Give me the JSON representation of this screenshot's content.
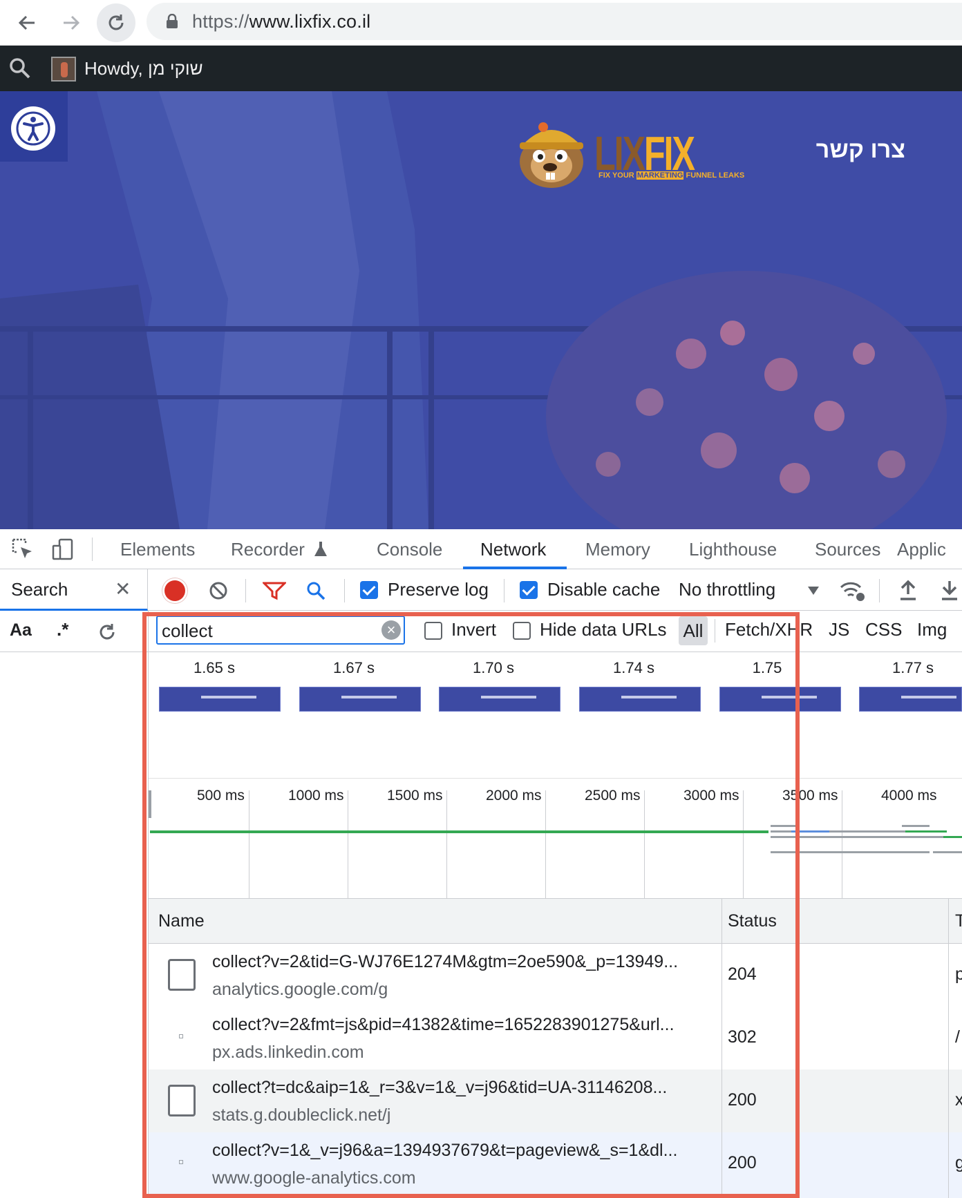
{
  "browser": {
    "url_scheme": "https://",
    "url_host": "www.lixfix.co.il"
  },
  "admin_bar": {
    "howdy": "Howdy, שוקי מן"
  },
  "hero": {
    "logo_lix": "LIX",
    "logo_fix": "FIX",
    "logo_tagline_1": "FIX YOUR ",
    "logo_tagline_hl": "MARKETING",
    "logo_tagline_2": " FUNNEL LEAKS",
    "contact_link": "צרו קשר",
    "overlay_color": "#3d4aa3"
  },
  "devtools": {
    "tabs": [
      "Elements",
      "Recorder",
      "Console",
      "Network",
      "Memory",
      "Lighthouse",
      "Sources",
      "Applic"
    ],
    "active_tab": "Network",
    "search_pane_label": "Search",
    "aa_label": "Aa",
    "regex_label": ".*",
    "preserve_log": {
      "label": "Preserve log",
      "checked": true
    },
    "disable_cache": {
      "label": "Disable cache",
      "checked": true
    },
    "throttling": "No throttling",
    "filter_value": "collect",
    "invert": {
      "label": "Invert",
      "checked": false
    },
    "hide_data_urls": {
      "label": "Hide data URLs",
      "checked": false
    },
    "type_filters": [
      "All",
      "Fetch/XHR",
      "JS",
      "CSS",
      "Img"
    ],
    "screenshot_times": [
      "1.65 s",
      "1.67 s",
      "1.70 s",
      "1.74 s",
      "1.75",
      "1.77 s"
    ],
    "timeline_ticks": [
      "500 ms",
      "1000 ms",
      "1500 ms",
      "2000 ms",
      "2500 ms",
      "3000 ms",
      "3500 ms",
      "4000 ms"
    ],
    "columns": {
      "name": "Name",
      "status": "Status",
      "type": "T"
    },
    "requests": [
      {
        "name": "collect?v=2&tid=G-WJ76E1274M&gtm=2oe590&_p=13949...",
        "domain": "analytics.google.com/g",
        "status": "204",
        "type": "p"
      },
      {
        "name": "collect?v=2&fmt=js&pid=41382&time=1652283901275&url...",
        "domain": "px.ads.linkedin.com",
        "status": "302",
        "type": "/"
      },
      {
        "name": "collect?t=dc&aip=1&_r=3&v=1&_v=j96&tid=UA-31146208...",
        "domain": "stats.g.doubleclick.net/j",
        "status": "200",
        "type": "x"
      },
      {
        "name": "collect?v=1&_v=j96&a=1394937679&t=pageview&_s=1&dl...",
        "domain": "www.google-analytics.com",
        "status": "200",
        "type": "g"
      }
    ],
    "highlight_color": "#e8614f"
  }
}
